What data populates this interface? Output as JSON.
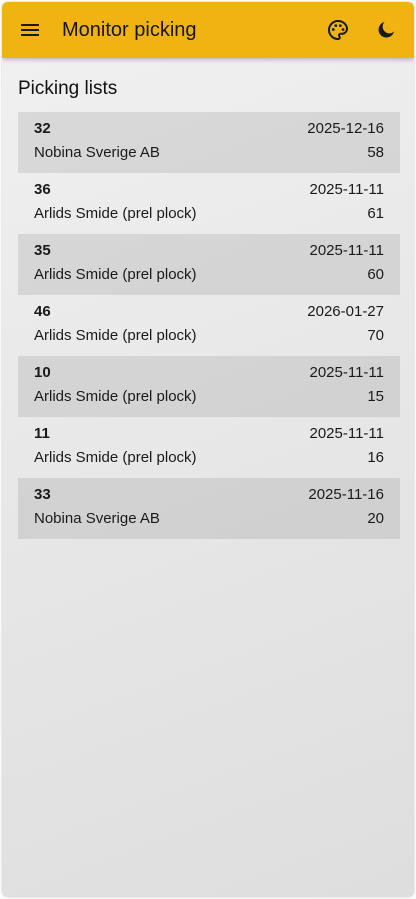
{
  "app": {
    "title": "Monitor picking",
    "accent_color": "#f0b312",
    "icons": {
      "menu": "menu-icon",
      "palette": "palette-icon",
      "theme": "moon-icon"
    }
  },
  "main": {
    "section_title": "Picking lists",
    "items": [
      {
        "number": "32",
        "date": "2025-12-16",
        "customer": "Nobina Sverige AB",
        "count": "58"
      },
      {
        "number": "36",
        "date": "2025-11-11",
        "customer": "Arlids Smide (prel plock)",
        "count": "61"
      },
      {
        "number": "35",
        "date": "2025-11-11",
        "customer": "Arlids Smide (prel plock)",
        "count": "60"
      },
      {
        "number": "46",
        "date": "2026-01-27",
        "customer": "Arlids Smide (prel plock)",
        "count": "70"
      },
      {
        "number": "10",
        "date": "2025-11-11",
        "customer": "Arlids Smide (prel plock)",
        "count": "15"
      },
      {
        "number": "11",
        "date": "2025-11-11",
        "customer": "Arlids Smide (prel plock)",
        "count": "16"
      },
      {
        "number": "33",
        "date": "2025-11-16",
        "customer": "Nobina Sverige AB",
        "count": "20"
      }
    ]
  }
}
